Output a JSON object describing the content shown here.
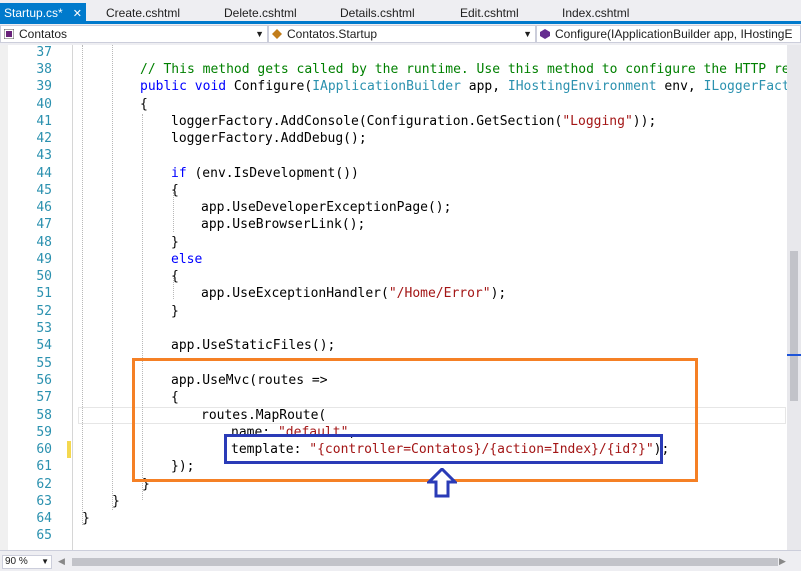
{
  "tabs": [
    {
      "label": "Startup.cs*",
      "close": "✕",
      "active": true
    },
    {
      "label": "Create.cshtml"
    },
    {
      "label": "Delete.cshtml"
    },
    {
      "label": "Details.cshtml"
    },
    {
      "label": "Edit.cshtml"
    },
    {
      "label": "Index.cshtml"
    }
  ],
  "nav": {
    "project": "Contatos",
    "class": "Contatos.Startup",
    "member": "Configure(IApplicationBuilder app, IHostingE"
  },
  "lines": [
    {
      "n": "37"
    },
    {
      "n": "38"
    },
    {
      "n": "39"
    },
    {
      "n": "40"
    },
    {
      "n": "41"
    },
    {
      "n": "42"
    },
    {
      "n": "43"
    },
    {
      "n": "44"
    },
    {
      "n": "45"
    },
    {
      "n": "46"
    },
    {
      "n": "47"
    },
    {
      "n": "48"
    },
    {
      "n": "49"
    },
    {
      "n": "50"
    },
    {
      "n": "51"
    },
    {
      "n": "52"
    },
    {
      "n": "53"
    },
    {
      "n": "54"
    },
    {
      "n": "55"
    },
    {
      "n": "56"
    },
    {
      "n": "57"
    },
    {
      "n": "58"
    },
    {
      "n": "59"
    },
    {
      "n": "60"
    },
    {
      "n": "61"
    },
    {
      "n": "62"
    },
    {
      "n": "63"
    },
    {
      "n": "64"
    },
    {
      "n": "65"
    }
  ],
  "code": {
    "l38": [
      [
        "cm",
        "// This method gets called by the runtime. Use this method to configure the HTTP reque"
      ]
    ],
    "l39": [
      [
        "kw",
        "public"
      ],
      [
        "",
        " "
      ],
      [
        "kw",
        "void"
      ],
      [
        "",
        " Configure("
      ],
      [
        "ty",
        "IApplicationBuilder"
      ],
      [
        "",
        " app, "
      ],
      [
        "ty",
        "IHostingEnvironment"
      ],
      [
        "",
        " env, "
      ],
      [
        "ty",
        "ILoggerFactory"
      ]
    ],
    "l40": [
      [
        "",
        "{"
      ]
    ],
    "l41": [
      [
        "",
        "loggerFactory.AddConsole(Configuration.GetSection("
      ],
      [
        "st",
        "\"Logging\""
      ],
      [
        "",
        "));"
      ]
    ],
    "l42": [
      [
        "",
        "loggerFactory.AddDebug();"
      ]
    ],
    "l44": [
      [
        "kw",
        "if"
      ],
      [
        "",
        " (env.IsDevelopment())"
      ]
    ],
    "l45": [
      [
        "",
        "{"
      ]
    ],
    "l46": [
      [
        "",
        "app.UseDeveloperExceptionPage();"
      ]
    ],
    "l47": [
      [
        "",
        "app.UseBrowserLink();"
      ]
    ],
    "l48": [
      [
        "",
        "}"
      ]
    ],
    "l49": [
      [
        "kw",
        "else"
      ]
    ],
    "l50": [
      [
        "",
        "{"
      ]
    ],
    "l51": [
      [
        "",
        "app.UseExceptionHandler("
      ],
      [
        "st",
        "\"/Home/Error\""
      ],
      [
        "",
        ");"
      ]
    ],
    "l52": [
      [
        "",
        "}"
      ]
    ],
    "l54": [
      [
        "",
        "app.UseStaticFiles();"
      ]
    ],
    "l56": [
      [
        "",
        "app.UseMvc(routes =>"
      ]
    ],
    "l57": [
      [
        "",
        "{"
      ]
    ],
    "l58": [
      [
        "",
        "routes.MapRoute("
      ]
    ],
    "l59": [
      [
        "",
        "name: "
      ],
      [
        "st",
        "\"default\""
      ],
      [
        "",
        ","
      ]
    ],
    "l60": [
      [
        "",
        "template: "
      ],
      [
        "st",
        "\"{controller=Contatos}/{action=Index}/{id?}\""
      ],
      [
        "",
        ");"
      ]
    ],
    "l61": [
      [
        "",
        "});"
      ]
    ],
    "l62": [
      [
        "",
        "}"
      ]
    ],
    "l63": [
      [
        "",
        "}"
      ]
    ],
    "l64": [
      [
        "",
        "}"
      ]
    ]
  },
  "zoom": "90 %",
  "colors": {
    "accent": "#007acc",
    "orange_annotation": "#f58025",
    "blue_annotation": "#2a3bb7"
  }
}
